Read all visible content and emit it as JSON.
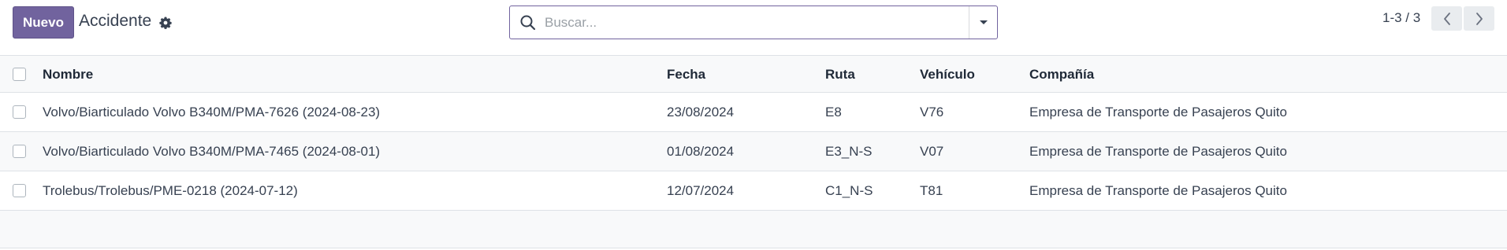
{
  "control_panel": {
    "new_button": "Nuevo",
    "title": "Accidente",
    "search_placeholder": "Buscar...",
    "pager": "1-3 / 3"
  },
  "colors": {
    "primary": "#71639e",
    "header_bg": "#f8f9fa",
    "border": "#dee2e6"
  },
  "icons": {
    "settings": "gear-icon",
    "search": "search-icon",
    "toggle": "caret-down-icon",
    "prev": "chevron-left-icon",
    "next": "chevron-right-icon"
  },
  "table": {
    "columns": [
      "Nombre",
      "Fecha",
      "Ruta",
      "Vehículo",
      "Compañía"
    ],
    "rows": [
      [
        "Volvo/Biarticulado Volvo B340M/PMA-7626 (2024-08-23)",
        "23/08/2024",
        "E8",
        "V76",
        "Empresa de Transporte de Pasajeros Quito"
      ],
      [
        "Volvo/Biarticulado Volvo B340M/PMA-7465 (2024-08-01)",
        "01/08/2024",
        "E3_N-S",
        "V07",
        "Empresa de Transporte de Pasajeros Quito"
      ],
      [
        "Trolebus/Trolebus/PME-0218 (2024-07-12)",
        "12/07/2024",
        "C1_N-S",
        "T81",
        "Empresa de Transporte de Pasajeros Quito"
      ]
    ]
  }
}
